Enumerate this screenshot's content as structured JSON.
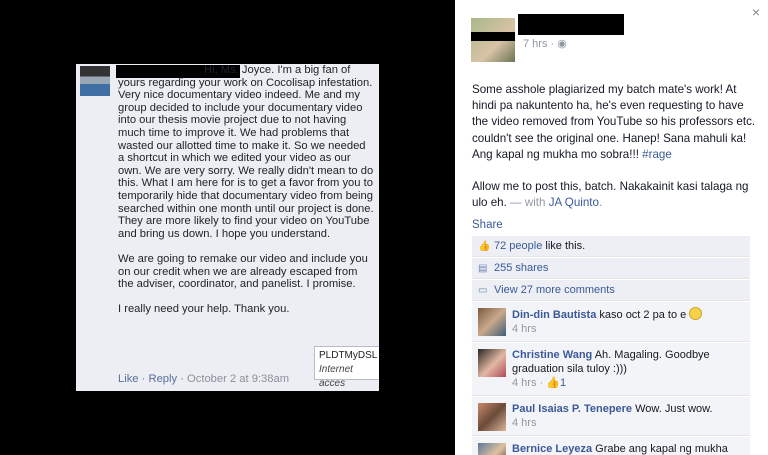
{
  "left_screenshot": {
    "comment_text": "Hi, Ms. Joyce. I'm a big fan of yours regarding your work on Cocolisap infestation. Very nice documentary video indeed. Me and my group decided to include your documentary video into our thesis movie project due to not having much time to improve it. We had problems that wasted our allotted time to make it. So we needed a shortcut in which we edited your video as our own. We are very sorry. We really didn't mean to do this. What I am here for is to get a favor from you to temporarily hide that documentary video from being searched within one month until our project is done. They are more likely to find your video on YouTube and bring us down. I hope you understand.\n\nWe are going to remake our video and include you on our credit when we are already escaped from the adviser, coordinator, and panelist. I promise.\n\nI really need your help. Thank you.",
    "actions": {
      "like": "Like",
      "sep": " · ",
      "reply": "Reply",
      "time": "October 2 at 9:38am"
    },
    "tooltip": {
      "line1": "PLDTMyDSL",
      "line2": "Internet acces"
    }
  },
  "post": {
    "close_glyph": "×",
    "meta_time": "7 hrs",
    "meta_sep": " · ",
    "audience_glyph": "◉",
    "paragraph1": "Some asshole plagiarized my batch mate's work! At hindi pa nakuntento ha, he's even requesting to have the video removed from YouTube so his professors etc. couldn't see the original one. Hanep! Sana mahuli ka! Ang kapal ng mukha mo sobra!!! ",
    "hashtag": "#rage",
    "paragraph2": "Allow me to post this, batch. Nakakainit kasi talaga ng ulo eh.",
    "with_prefix": " — with ",
    "tagged": "JA Quinto",
    "tagged_end": "."
  },
  "share_label": "Share",
  "ufi": {
    "likes_count": "72 people",
    "likes_suffix": " like this.",
    "shares": "255 shares",
    "view_more": "View 27 more comments"
  },
  "comments": [
    {
      "name": "Din-din Bautista",
      "text": " kaso oct 2 pa to e ",
      "time": "4 hrs",
      "likes": ""
    },
    {
      "name": "Christine Wang",
      "text": " Ah. Magaling. Goodbye graduation sila tuloy :)))",
      "time": "4 hrs",
      "sep": " · ",
      "likes": "1"
    },
    {
      "name": "Paul Isaias P. Tenepere",
      "text": " Wow. Just wow.",
      "time": "4 hrs",
      "likes": ""
    },
    {
      "name": "Bernice Leyeza",
      "text": " Grabe ang kapal ng mukha magrequest!!!!!!!!! Sana di sila makagraduate or",
      "time": "",
      "likes": ""
    }
  ],
  "colors": {
    "link": "#3b5998",
    "ufi_bg": "#edeff4",
    "background": "#000000"
  }
}
